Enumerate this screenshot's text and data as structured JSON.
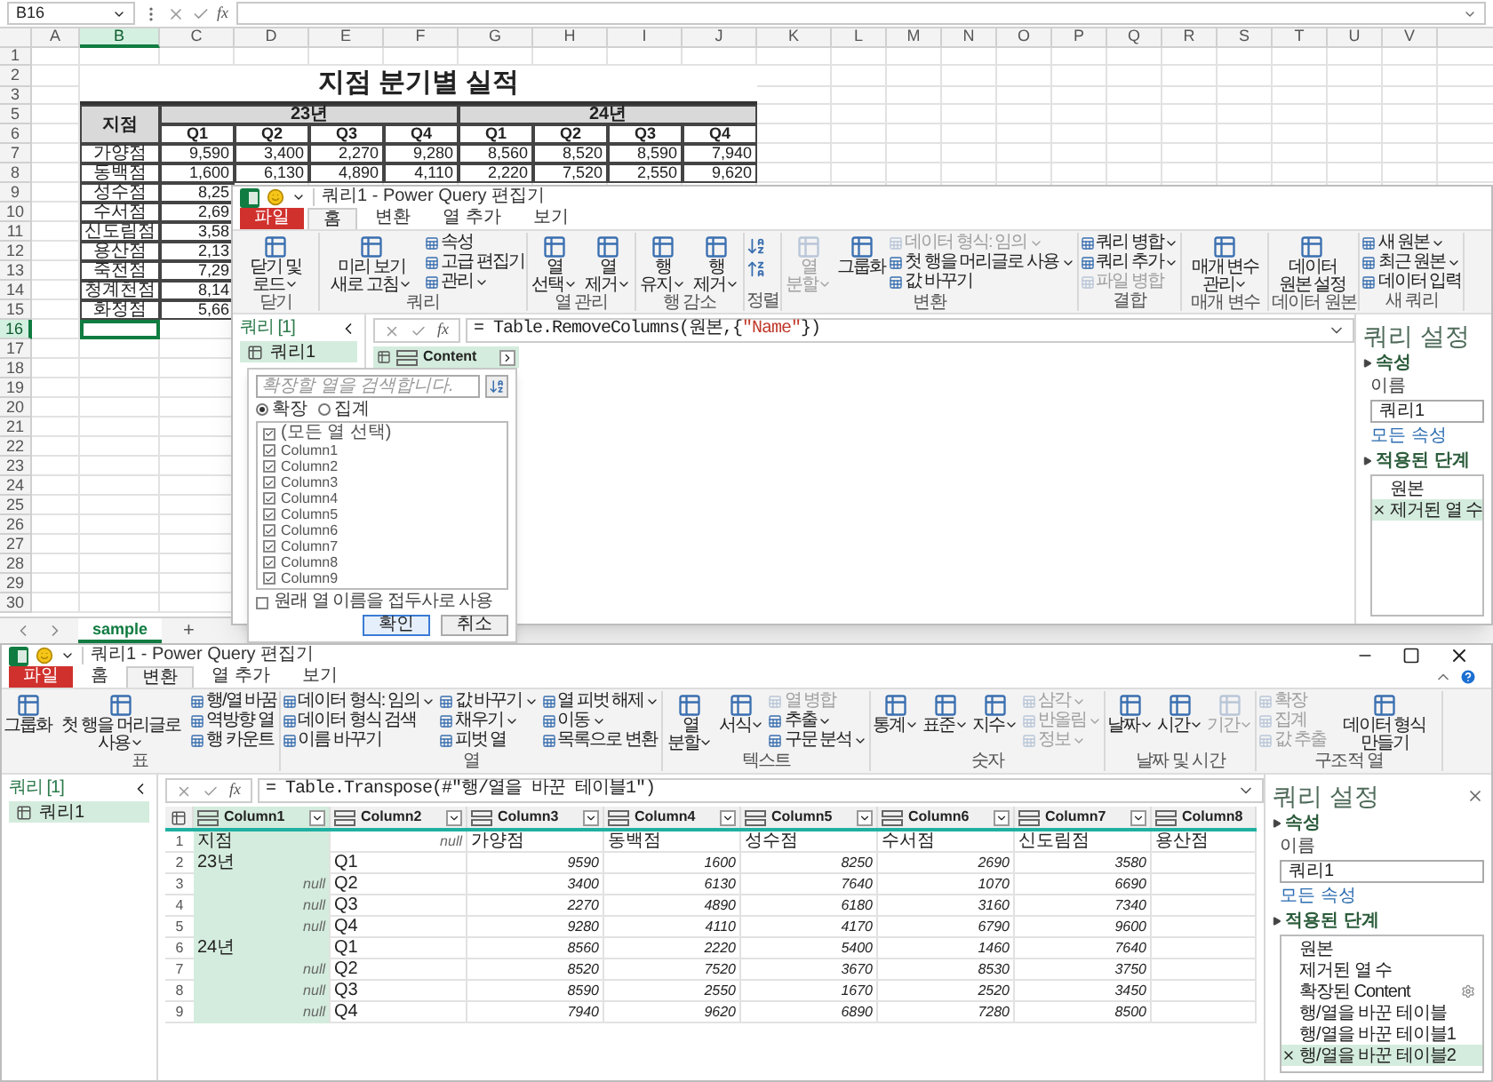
{
  "excel": {
    "name_box": "B16",
    "fx": "fx",
    "columns": [
      {
        "label": "A",
        "selected": false
      },
      {
        "label": "B",
        "selected": true
      },
      {
        "label": "C",
        "selected": false
      },
      {
        "label": "D",
        "selected": false
      },
      {
        "label": "E",
        "selected": false
      },
      {
        "label": "F",
        "selected": false
      },
      {
        "label": "G",
        "selected": false
      },
      {
        "label": "H",
        "selected": false
      },
      {
        "label": "I",
        "selected": false
      },
      {
        "label": "J",
        "selected": false
      },
      {
        "label": "K",
        "selected": false
      },
      {
        "label": "L",
        "selected": false
      },
      {
        "label": "M",
        "selected": false
      },
      {
        "label": "N",
        "selected": false
      },
      {
        "label": "O",
        "selected": false
      },
      {
        "label": "P",
        "selected": false
      },
      {
        "label": "Q",
        "selected": false
      },
      {
        "label": "R",
        "selected": false
      },
      {
        "label": "S",
        "selected": false
      },
      {
        "label": "T",
        "selected": false
      },
      {
        "label": "U",
        "selected": false
      },
      {
        "label": "V",
        "selected": false
      }
    ],
    "rows": [
      {
        "label": "1",
        "selected": false
      },
      {
        "label": "2",
        "selected": false
      },
      {
        "label": "3",
        "selected": false
      },
      {
        "label": "5",
        "selected": false
      },
      {
        "label": "6",
        "selected": false
      },
      {
        "label": "7",
        "selected": false
      },
      {
        "label": "8",
        "selected": false
      },
      {
        "label": "9",
        "selected": false
      },
      {
        "label": "10",
        "selected": false
      },
      {
        "label": "11",
        "selected": false
      },
      {
        "label": "12",
        "selected": false
      },
      {
        "label": "13",
        "selected": false
      },
      {
        "label": "14",
        "selected": false
      },
      {
        "label": "15",
        "selected": false
      },
      {
        "label": "16",
        "selected": true
      },
      {
        "label": "17",
        "selected": false
      },
      {
        "label": "18",
        "selected": false
      },
      {
        "label": "19",
        "selected": false
      },
      {
        "label": "20",
        "selected": false
      },
      {
        "label": "21",
        "selected": false
      },
      {
        "label": "22",
        "selected": false
      },
      {
        "label": "23",
        "selected": false
      },
      {
        "label": "24",
        "selected": false
      },
      {
        "label": "25",
        "selected": false
      },
      {
        "label": "26",
        "selected": false
      },
      {
        "label": "27",
        "selected": false
      },
      {
        "label": "28",
        "selected": false
      },
      {
        "label": "29",
        "selected": false
      },
      {
        "label": "30",
        "selected": false
      }
    ],
    "title": "지점 분기별 실적",
    "table": {
      "branch_header": "지점",
      "years": [
        "23년",
        "24년"
      ],
      "quarters": [
        "Q1",
        "Q2",
        "Q3",
        "Q4",
        "Q1",
        "Q2",
        "Q3",
        "Q4"
      ],
      "rows": [
        {
          "branch": "가양점",
          "values": [
            "9,590",
            "3,400",
            "2,270",
            "9,280",
            "8,560",
            "8,520",
            "8,590",
            "7,940"
          ]
        },
        {
          "branch": "동백점",
          "values": [
            "1,600",
            "6,130",
            "4,890",
            "4,110",
            "2,220",
            "7,520",
            "2,550",
            "9,620"
          ]
        },
        {
          "branch": "성수점",
          "values": [
            "8,25"
          ]
        },
        {
          "branch": "수서점",
          "values": [
            "2,69"
          ]
        },
        {
          "branch": "신도림점",
          "values": [
            "3,58"
          ]
        },
        {
          "branch": "용산점",
          "values": [
            "2,13"
          ]
        },
        {
          "branch": "죽전점",
          "values": [
            "7,29"
          ]
        },
        {
          "branch": "청계천점",
          "values": [
            "8,14"
          ]
        },
        {
          "branch": "화정점",
          "values": [
            "5,66"
          ]
        }
      ]
    },
    "sheets": [
      {
        "label": "sample",
        "selected": true
      }
    ],
    "add_sheet": "+"
  },
  "editor_back": {
    "title": "쿼리1 - Power Query 편집기",
    "tabs": [
      {
        "label": "파일",
        "kind": "file",
        "selected": false
      },
      {
        "label": "홈",
        "kind": "tab",
        "selected": true
      },
      {
        "label": "변환",
        "kind": "tab",
        "selected": false
      },
      {
        "label": "열 추가",
        "kind": "tab",
        "selected": false
      },
      {
        "label": "보기",
        "kind": "tab",
        "selected": false
      }
    ],
    "ribbon": [
      {
        "label": "닫기",
        "items": [
          {
            "kind": "large",
            "label": "닫기 및 로드",
            "caret": true,
            "disabled": false
          }
        ]
      },
      {
        "label": "쿼리",
        "items": [
          {
            "kind": "large",
            "label": "미리 보기 새로 고침",
            "caret": true,
            "disabled": false
          },
          {
            "kind": "stack",
            "items": [
              {
                "label": "속성",
                "caret": false,
                "disabled": false
              },
              {
                "label": "고급 편집기",
                "caret": false,
                "disabled": false
              },
              {
                "label": "관리",
                "caret": true,
                "disabled": false
              }
            ]
          }
        ]
      },
      {
        "label": "열 관리",
        "items": [
          {
            "kind": "large",
            "label": "열 선택",
            "caret": true,
            "disabled": false
          },
          {
            "kind": "large",
            "label": "열 제거",
            "caret": true,
            "disabled": false
          }
        ]
      },
      {
        "label": "행 감소",
        "items": [
          {
            "kind": "large",
            "label": "행 유지",
            "caret": true,
            "disabled": false
          },
          {
            "kind": "large",
            "label": "행 제거",
            "caret": true,
            "disabled": false
          }
        ]
      },
      {
        "label": "정렬",
        "items": [
          {
            "kind": "sort"
          }
        ]
      },
      {
        "label": "변환",
        "items": [
          {
            "kind": "large",
            "label": "열 분할",
            "caret": true,
            "disabled": true
          },
          {
            "kind": "large",
            "label": "그룹화",
            "caret": false,
            "disabled": false
          },
          {
            "kind": "stack",
            "items": [
              {
                "label": "데이터 형식: 임의",
                "caret": true,
                "disabled": true
              },
              {
                "label": "첫 행을 머리글로 사용",
                "caret": true,
                "disabled": false
              },
              {
                "label": "값 바꾸기",
                "caret": false,
                "disabled": false
              }
            ]
          }
        ]
      },
      {
        "label": "결합",
        "items": [
          {
            "kind": "stack",
            "items": [
              {
                "label": "쿼리 병합",
                "caret": true,
                "disabled": false
              },
              {
                "label": "쿼리 추가",
                "caret": true,
                "disabled": false
              },
              {
                "label": "파일 병합",
                "caret": false,
                "disabled": true
              }
            ]
          }
        ]
      },
      {
        "label": "매개 변수",
        "items": [
          {
            "kind": "large",
            "label": "매개 변수 관리",
            "caret": true,
            "disabled": false
          }
        ]
      },
      {
        "label": "데이터 원본",
        "items": [
          {
            "kind": "large",
            "label": "데이터 원본 설정",
            "caret": false,
            "disabled": false
          }
        ]
      },
      {
        "label": "새 쿼리",
        "items": [
          {
            "kind": "stack",
            "items": [
              {
                "label": "새 원본",
                "caret": true,
                "disabled": false
              },
              {
                "label": "최근 원본",
                "caret": true,
                "disabled": false
              },
              {
                "label": "데이터 입력",
                "caret": false,
                "disabled": false
              }
            ]
          }
        ]
      }
    ],
    "queries_header": "쿼리 [1]",
    "queries": [
      {
        "label": "쿼리1",
        "selected": true
      }
    ],
    "fx": "fx",
    "formula": [
      {
        "text": "= Table.RemoveColumns(원본,{",
        "kind": "code"
      },
      {
        "text": "\"Name\"",
        "kind": "string"
      },
      {
        "text": "})",
        "kind": "code"
      }
    ],
    "column": {
      "name": "Content",
      "selected": true
    },
    "expand_dialog": {
      "search": {
        "placeholder": "확장할 열을 검색합니다."
      },
      "modes": [
        {
          "label": "확장",
          "selected": true
        },
        {
          "label": "집계",
          "selected": false
        }
      ],
      "columns": [
        {
          "label": "(모든 열 선택)",
          "checked": true
        },
        {
          "label": "Column1",
          "checked": true
        },
        {
          "label": "Column2",
          "checked": true
        },
        {
          "label": "Column3",
          "checked": true
        },
        {
          "label": "Column4",
          "checked": true
        },
        {
          "label": "Column5",
          "checked": true
        },
        {
          "label": "Column6",
          "checked": true
        },
        {
          "label": "Column7",
          "checked": true
        },
        {
          "label": "Column8",
          "checked": true
        },
        {
          "label": "Column9",
          "checked": true
        }
      ],
      "prefix": {
        "label": "원래 열 이름을 접두사로 사용",
        "checked": false
      },
      "buttons": [
        {
          "label": "확인",
          "kind": "primary"
        },
        {
          "label": "취소",
          "kind": "secondary"
        }
      ]
    },
    "settings": {
      "title": "쿼리 설정",
      "properties": "속성",
      "name_label": "이름",
      "name_value": "쿼리1",
      "all_properties": "모든 속성",
      "steps_header": "적용된 단계",
      "steps": [
        {
          "label": "원본",
          "selected": false,
          "settings": false
        },
        {
          "label": "제거된 열 수",
          "selected": true,
          "settings": false
        }
      ]
    }
  },
  "editor_front": {
    "title": "쿼리1 - Power Query 편집기",
    "controls": true,
    "tabs": [
      {
        "label": "파일",
        "kind": "file",
        "selected": false
      },
      {
        "label": "홈",
        "kind": "tab",
        "selected": false
      },
      {
        "label": "변환",
        "kind": "tab",
        "selected": true
      },
      {
        "label": "열 추가",
        "kind": "tab",
        "selected": false
      },
      {
        "label": "보기",
        "kind": "tab",
        "selected": false
      }
    ],
    "ribbon": [
      {
        "label": "표",
        "items": [
          {
            "kind": "large",
            "label": "그룹화",
            "caret": false,
            "disabled": false
          },
          {
            "kind": "large",
            "label": "첫 행을 머리글로 사용",
            "caret": true,
            "disabled": false
          },
          {
            "kind": "stack",
            "items": [
              {
                "label": "행/열 바꿈",
                "caret": false,
                "disabled": false
              },
              {
                "label": "역방향 열",
                "caret": false,
                "disabled": false
              },
              {
                "label": "행 카운트",
                "caret": false,
                "disabled": false
              }
            ]
          }
        ]
      },
      {
        "label": "열",
        "items": [
          {
            "kind": "stack",
            "items": [
              {
                "label": "데이터 형식: 임의",
                "caret": true,
                "disabled": false
              },
              {
                "label": "데이터 형식 검색",
                "caret": false,
                "disabled": false
              },
              {
                "label": "이름 바꾸기",
                "caret": false,
                "disabled": false
              }
            ]
          },
          {
            "kind": "stack",
            "items": [
              {
                "label": "값 바꾸기",
                "caret": true,
                "disabled": false
              },
              {
                "label": "채우기",
                "caret": true,
                "disabled": false
              },
              {
                "label": "피벗 열",
                "caret": false,
                "disabled": false
              }
            ]
          },
          {
            "kind": "stack",
            "items": [
              {
                "label": "열 피벗 해제",
                "caret": true,
                "disabled": false
              },
              {
                "label": "이동",
                "caret": true,
                "disabled": false
              },
              {
                "label": "목록으로 변환",
                "caret": false,
                "disabled": false
              }
            ]
          }
        ]
      },
      {
        "label": "텍스트",
        "items": [
          {
            "kind": "large",
            "label": "열 분할",
            "caret": true,
            "disabled": false
          },
          {
            "kind": "large",
            "label": "서식",
            "caret": true,
            "disabled": false
          },
          {
            "kind": "stack",
            "items": [
              {
                "label": "열 병합",
                "caret": false,
                "disabled": true
              },
              {
                "label": "추출",
                "caret": true,
                "disabled": false
              },
              {
                "label": "구문 분석",
                "caret": true,
                "disabled": false
              }
            ]
          }
        ]
      },
      {
        "label": "숫자",
        "items": [
          {
            "kind": "large",
            "label": "통계",
            "caret": true,
            "disabled": false
          },
          {
            "kind": "large",
            "label": "표준",
            "caret": true,
            "disabled": false
          },
          {
            "kind": "large",
            "label": "지수",
            "caret": true,
            "disabled": false
          },
          {
            "kind": "stack",
            "items": [
              {
                "label": "삼각",
                "caret": true,
                "disabled": true
              },
              {
                "label": "반올림",
                "caret": true,
                "disabled": true
              },
              {
                "label": "정보",
                "caret": true,
                "disabled": true
              }
            ]
          }
        ]
      },
      {
        "label": "날짜 및 시간",
        "items": [
          {
            "kind": "large",
            "label": "날짜",
            "caret": true,
            "disabled": false
          },
          {
            "kind": "large",
            "label": "시간",
            "caret": true,
            "disabled": false
          },
          {
            "kind": "large",
            "label": "기간",
            "caret": true,
            "disabled": true
          }
        ]
      },
      {
        "label": "구조적 열",
        "items": [
          {
            "kind": "stack",
            "items": [
              {
                "label": "확장",
                "caret": false,
                "disabled": true
              },
              {
                "label": "집계",
                "caret": false,
                "disabled": true
              },
              {
                "label": "값 추출",
                "caret": false,
                "disabled": true
              }
            ]
          },
          {
            "kind": "large",
            "label": "데이터 형식 만들기",
            "caret": false,
            "disabled": false
          }
        ]
      }
    ],
    "queries_header": "쿼리 [1]",
    "queries": [
      {
        "label": "쿼리1",
        "selected": true
      }
    ],
    "fx": "fx",
    "formula": [
      {
        "text": "= Table.Transpose(#\"행/열을 바꾼 테이블1\")",
        "kind": "code"
      }
    ],
    "table": {
      "columns": [
        {
          "name": "Column1",
          "selected": true
        },
        {
          "name": "Column2",
          "selected": false
        },
        {
          "name": "Column3",
          "selected": false
        },
        {
          "name": "Column4",
          "selected": false
        },
        {
          "name": "Column5",
          "selected": false
        },
        {
          "name": "Column6",
          "selected": false
        },
        {
          "name": "Column7",
          "selected": false
        },
        {
          "name": "Column8",
          "selected": false
        }
      ],
      "rows": [
        {
          "number": "1",
          "cells": [
            {
              "text": "지점",
              "kind": "text"
            },
            {
              "text": "null",
              "kind": "null"
            },
            {
              "text": "가양점",
              "kind": "text"
            },
            {
              "text": "동백점",
              "kind": "text"
            },
            {
              "text": "성수점",
              "kind": "text"
            },
            {
              "text": "수서점",
              "kind": "text"
            },
            {
              "text": "신도림점",
              "kind": "text"
            },
            {
              "text": "용산점",
              "kind": "text"
            }
          ]
        },
        {
          "number": "2",
          "cells": [
            {
              "text": "23년",
              "kind": "text"
            },
            {
              "text": "Q1",
              "kind": "text"
            },
            {
              "text": "9590",
              "kind": "number"
            },
            {
              "text": "1600",
              "kind": "number"
            },
            {
              "text": "8250",
              "kind": "number"
            },
            {
              "text": "2690",
              "kind": "number"
            },
            {
              "text": "3580",
              "kind": "number"
            }
          ]
        },
        {
          "number": "3",
          "cells": [
            {
              "text": "null",
              "kind": "null"
            },
            {
              "text": "Q2",
              "kind": "text"
            },
            {
              "text": "3400",
              "kind": "number"
            },
            {
              "text": "6130",
              "kind": "number"
            },
            {
              "text": "7640",
              "kind": "number"
            },
            {
              "text": "1070",
              "kind": "number"
            },
            {
              "text": "6690",
              "kind": "number"
            }
          ]
        },
        {
          "number": "4",
          "cells": [
            {
              "text": "null",
              "kind": "null"
            },
            {
              "text": "Q3",
              "kind": "text"
            },
            {
              "text": "2270",
              "kind": "number"
            },
            {
              "text": "4890",
              "kind": "number"
            },
            {
              "text": "6180",
              "kind": "number"
            },
            {
              "text": "3160",
              "kind": "number"
            },
            {
              "text": "7340",
              "kind": "number"
            }
          ]
        },
        {
          "number": "5",
          "cells": [
            {
              "text": "null",
              "kind": "null"
            },
            {
              "text": "Q4",
              "kind": "text"
            },
            {
              "text": "9280",
              "kind": "number"
            },
            {
              "text": "4110",
              "kind": "number"
            },
            {
              "text": "4170",
              "kind": "number"
            },
            {
              "text": "6790",
              "kind": "number"
            },
            {
              "text": "9600",
              "kind": "number"
            }
          ]
        },
        {
          "number": "6",
          "cells": [
            {
              "text": "24년",
              "kind": "text"
            },
            {
              "text": "Q1",
              "kind": "text"
            },
            {
              "text": "8560",
              "kind": "number"
            },
            {
              "text": "2220",
              "kind": "number"
            },
            {
              "text": "5400",
              "kind": "number"
            },
            {
              "text": "1460",
              "kind": "number"
            },
            {
              "text": "7640",
              "kind": "number"
            }
          ]
        },
        {
          "number": "7",
          "cells": [
            {
              "text": "null",
              "kind": "null"
            },
            {
              "text": "Q2",
              "kind": "text"
            },
            {
              "text": "8520",
              "kind": "number"
            },
            {
              "text": "7520",
              "kind": "number"
            },
            {
              "text": "3670",
              "kind": "number"
            },
            {
              "text": "8530",
              "kind": "number"
            },
            {
              "text": "3750",
              "kind": "number"
            }
          ]
        },
        {
          "number": "8",
          "cells": [
            {
              "text": "null",
              "kind": "null"
            },
            {
              "text": "Q3",
              "kind": "text"
            },
            {
              "text": "8590",
              "kind": "number"
            },
            {
              "text": "2550",
              "kind": "number"
            },
            {
              "text": "1670",
              "kind": "number"
            },
            {
              "text": "2520",
              "kind": "number"
            },
            {
              "text": "3450",
              "kind": "number"
            }
          ]
        },
        {
          "number": "9",
          "cells": [
            {
              "text": "null",
              "kind": "null"
            },
            {
              "text": "Q4",
              "kind": "text"
            },
            {
              "text": "7940",
              "kind": "number"
            },
            {
              "text": "9620",
              "kind": "number"
            },
            {
              "text": "6890",
              "kind": "number"
            },
            {
              "text": "7280",
              "kind": "number"
            },
            {
              "text": "8500",
              "kind": "number"
            }
          ]
        }
      ]
    },
    "settings": {
      "title": "쿼리 설정",
      "properties": "속성",
      "name_label": "이름",
      "name_value": "쿼리1",
      "all_properties": "모든 속성",
      "steps_header": "적용된 단계",
      "steps": [
        {
          "label": "원본",
          "selected": false,
          "settings": false
        },
        {
          "label": "제거된 열 수",
          "selected": false,
          "settings": false
        },
        {
          "label": "확장된 Content",
          "selected": false,
          "settings": true
        },
        {
          "label": "행/열을 바꾼 테이블",
          "selected": false,
          "settings": false
        },
        {
          "label": "행/열을 바꾼 테이블1",
          "selected": false,
          "settings": false
        },
        {
          "label": "행/열을 바꾼 테이블2",
          "selected": true,
          "settings": false
        }
      ]
    }
  }
}
